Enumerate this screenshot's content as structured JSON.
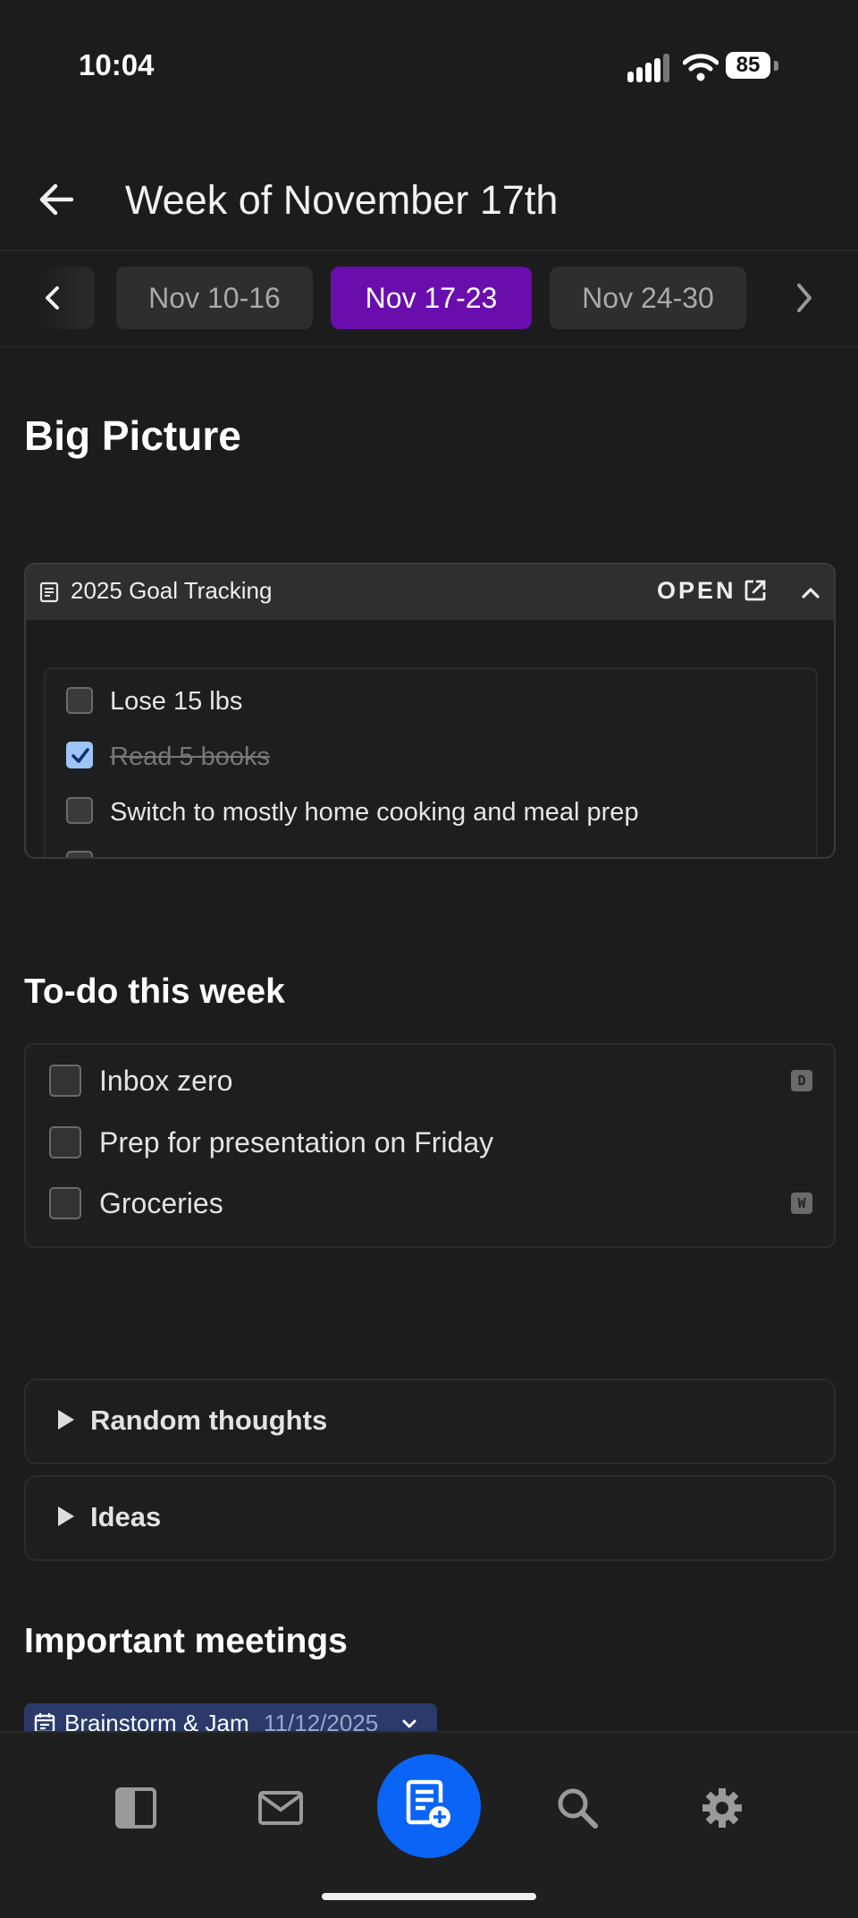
{
  "status_bar": {
    "time": "10:04",
    "battery": "85"
  },
  "header": {
    "title": "Week of November 17th"
  },
  "week_nav": {
    "weeks": [
      "Nov 10-16",
      "Nov 17-23",
      "Nov 24-30"
    ],
    "active": "Nov 17-23"
  },
  "big_picture": {
    "heading": "Big Picture",
    "embed": {
      "title": "2025 Goal Tracking",
      "open_label": "OPEN",
      "goals": [
        {
          "text": "Lose 15 lbs",
          "checked": false
        },
        {
          "text": "Read 5 books",
          "checked": true
        },
        {
          "text": "Switch to mostly home cooking and meal prep",
          "checked": false
        }
      ]
    }
  },
  "todo": {
    "heading": "To-do this week",
    "items": [
      {
        "text": "Inbox zero",
        "checked": false,
        "badge": "D"
      },
      {
        "text": "Prep for presentation on Friday",
        "checked": false,
        "badge": ""
      },
      {
        "text": "Groceries",
        "checked": false,
        "badge": "W"
      }
    ]
  },
  "toggles": [
    "Random thoughts",
    "Ideas"
  ],
  "meetings": {
    "heading": "Important meetings",
    "items": [
      {
        "title": "Brainstorm & Jam",
        "date": "11/12/2025"
      }
    ]
  },
  "bottom_nav": [
    "sidebar-icon",
    "mail-icon",
    "new-note-icon",
    "search-icon",
    "settings-icon"
  ],
  "colors": {
    "accent": "#6a0dad",
    "fab": "#0a64f5",
    "background": "#1c1c1c",
    "check": "#9fc5f8"
  }
}
